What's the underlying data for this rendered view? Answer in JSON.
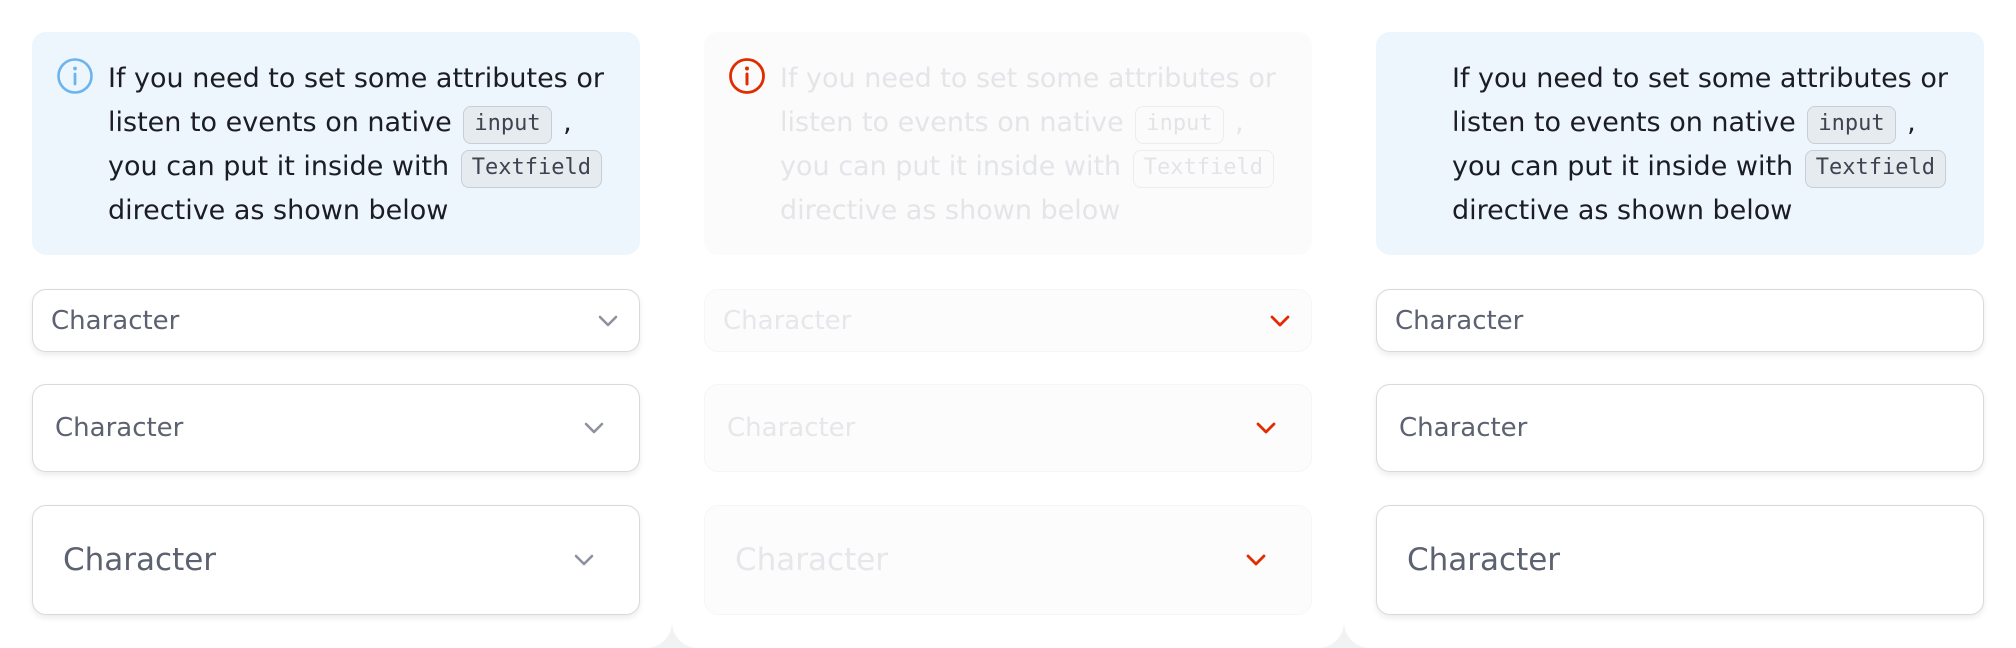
{
  "panels": [
    {
      "state": "default",
      "icon": "info-circle-icon",
      "message": {
        "text_before_input": "If you need to set some attributes or listen to events on native",
        "code_input": "input",
        "text_after_input": ", you can put it inside with",
        "code_textfield": "Textfield",
        "text_end": "directive as shown below"
      },
      "fields": [
        {
          "size": "small",
          "placeholder": "Character",
          "icon": "chevron-down-icon"
        },
        {
          "size": "medium",
          "placeholder": "Character",
          "icon": "chevron-down-icon"
        },
        {
          "size": "large",
          "placeholder": "Character",
          "icon": "chevron-down-icon"
        }
      ]
    },
    {
      "state": "disabled",
      "icon": "alert-circle-icon",
      "message": {
        "text_before_input": "If you need to set some attributes or listen to events on native",
        "code_input": "input",
        "text_after_input": ", you can put it inside with",
        "code_textfield": "Textfield",
        "text_end": "directive as shown below"
      },
      "fields": [
        {
          "size": "small",
          "placeholder": "Character",
          "icon": "chevron-down-icon"
        },
        {
          "size": "medium",
          "placeholder": "Character",
          "icon": "chevron-down-icon"
        },
        {
          "size": "large",
          "placeholder": "Character",
          "icon": "chevron-down-icon"
        }
      ]
    },
    {
      "state": "no-icon",
      "message": {
        "text_before_input": "If you need to set some attributes or listen to events on native",
        "code_input": "input",
        "text_after_input": ", you can put it inside with",
        "code_textfield": "Textfield",
        "text_end": "directive as shown below"
      },
      "fields": [
        {
          "size": "small",
          "placeholder": "Character"
        },
        {
          "size": "medium",
          "placeholder": "Character"
        },
        {
          "size": "large",
          "placeholder": "Character"
        }
      ]
    }
  ],
  "colors": {
    "note_background": "#edf5fd",
    "info_icon": "#6cb4ee",
    "alert_icon": "#e02d00",
    "chevron": "#8d929c",
    "chevron_disabled": "#e02d00",
    "text": "#1b1d22",
    "placeholder": "#5c6270"
  }
}
